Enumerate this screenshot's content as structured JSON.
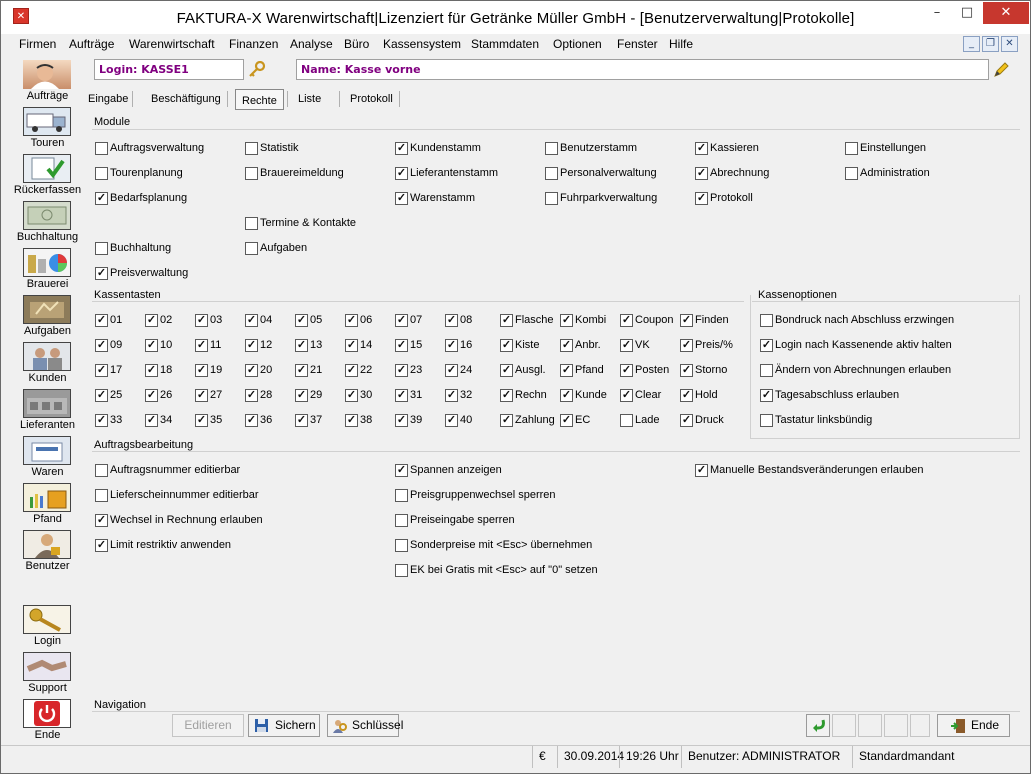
{
  "window": {
    "title": "FAKTURA-X Warenwirtschaft|Lizenziert für Getränke Müller GmbH - [Benutzerverwaltung|Protokolle]"
  },
  "menu": [
    "Firmen",
    "Aufträge",
    "Warenwirtschaft",
    "Finanzen",
    "Analyse",
    "Büro",
    "Kassensystem",
    "Stammdaten",
    "Optionen",
    "Fenster",
    "Hilfe"
  ],
  "sidebar": [
    "Aufträge",
    "Touren",
    "Rückerfassen",
    "Buchhaltung",
    "Brauerei",
    "Aufgaben",
    "Kunden",
    "Lieferanten",
    "Waren",
    "Pfand",
    "Benutzer",
    "Login",
    "Support",
    "Ende"
  ],
  "header": {
    "login": "Login: KASSE1",
    "name": "Name: Kasse vorne"
  },
  "tabs": [
    "Eingabe",
    "Beschäftigung",
    "Rechte",
    "Liste",
    "Protokoll"
  ],
  "active_tab": "Rechte",
  "module": {
    "title": "Module",
    "items": [
      {
        "label": "Auftragsverwaltung",
        "checked": false
      },
      {
        "label": "Statistik",
        "checked": false
      },
      {
        "label": "Kundenstamm",
        "checked": true
      },
      {
        "label": "Benutzerstamm",
        "checked": false
      },
      {
        "label": "Kassieren",
        "checked": true
      },
      {
        "label": "Einstellungen",
        "checked": false
      },
      {
        "label": "Tourenplanung",
        "checked": false
      },
      {
        "label": "Brauereimeldung",
        "checked": false
      },
      {
        "label": "Lieferantenstamm",
        "checked": true
      },
      {
        "label": "Personalverwaltung",
        "checked": false
      },
      {
        "label": "Abrechnung",
        "checked": true
      },
      {
        "label": "Administration",
        "checked": false
      },
      {
        "label": "Bedarfsplanung",
        "checked": true
      },
      {
        "label": "Warenstamm",
        "checked": true
      },
      {
        "label": "Fuhrparkverwaltung",
        "checked": false
      },
      {
        "label": "Protokoll",
        "checked": true
      },
      {
        "label": "Termine & Kontakte",
        "checked": false
      },
      {
        "label": "Buchhaltung",
        "checked": false
      },
      {
        "label": "Aufgaben",
        "checked": false
      },
      {
        "label": "Preisverwaltung",
        "checked": true
      }
    ]
  },
  "kassentasten": {
    "title": "Kassentasten",
    "rows": [
      [
        "01",
        "02",
        "03",
        "04",
        "05",
        "06",
        "07",
        "08",
        "Flasche",
        "Kombi",
        "Coupon",
        "Finden"
      ],
      [
        "09",
        "10",
        "11",
        "12",
        "13",
        "14",
        "15",
        "16",
        "Kiste",
        "Anbr.",
        "VK",
        "Preis/%"
      ],
      [
        "17",
        "18",
        "19",
        "20",
        "21",
        "22",
        "23",
        "24",
        "Ausgl.",
        "Pfand",
        "Posten",
        "Storno"
      ],
      [
        "25",
        "26",
        "27",
        "28",
        "29",
        "30",
        "31",
        "32",
        "Rechn",
        "Kunde",
        "Clear",
        "Hold"
      ],
      [
        "33",
        "34",
        "35",
        "36",
        "37",
        "38",
        "39",
        "40",
        "Zahlung",
        "EC",
        "Lade",
        "Druck"
      ]
    ],
    "unchecked": [
      "Lade"
    ]
  },
  "kassenoptionen": {
    "title": "Kassenoptionen",
    "items": [
      {
        "label": "Bondruck nach Abschluss erzwingen",
        "checked": false
      },
      {
        "label": "Login nach Kassenende aktiv halten",
        "checked": true
      },
      {
        "label": "Ändern von Abrechnungen erlauben",
        "checked": false
      },
      {
        "label": "Tagesabschluss erlauben",
        "checked": true
      },
      {
        "label": "Tastatur linksbündig",
        "checked": false
      }
    ]
  },
  "auftragsbearbeitung": {
    "title": "Auftragsbearbeitung",
    "items": [
      {
        "label": "Auftragsnummer editierbar",
        "checked": false
      },
      {
        "label": "Lieferscheinnummer editierbar",
        "checked": false
      },
      {
        "label": "Wechsel in Rechnung erlauben",
        "checked": true
      },
      {
        "label": "Limit restriktiv anwenden",
        "checked": true
      },
      {
        "label": "Spannen anzeigen",
        "checked": true
      },
      {
        "label": "Preisgruppenwechsel sperren",
        "checked": false
      },
      {
        "label": "Preiseingabe sperren",
        "checked": false
      },
      {
        "label": "Sonderpreise mit <Esc> übernehmen",
        "checked": false
      },
      {
        "label": "EK bei Gratis mit <Esc> auf \"0\" setzen",
        "checked": false
      },
      {
        "label": "Manuelle Bestandsveränderungen erlauben",
        "checked": true
      }
    ]
  },
  "navigation": {
    "title": "Navigation",
    "edit": "Editieren",
    "save": "Sichern",
    "key": "Schlüssel",
    "end": "Ende"
  },
  "status": {
    "currency": "€",
    "date": "30.09.2014",
    "time": "19:26 Uhr",
    "user": "Benutzer: ADMINISTRATOR",
    "mandant": "Standardmandant"
  }
}
